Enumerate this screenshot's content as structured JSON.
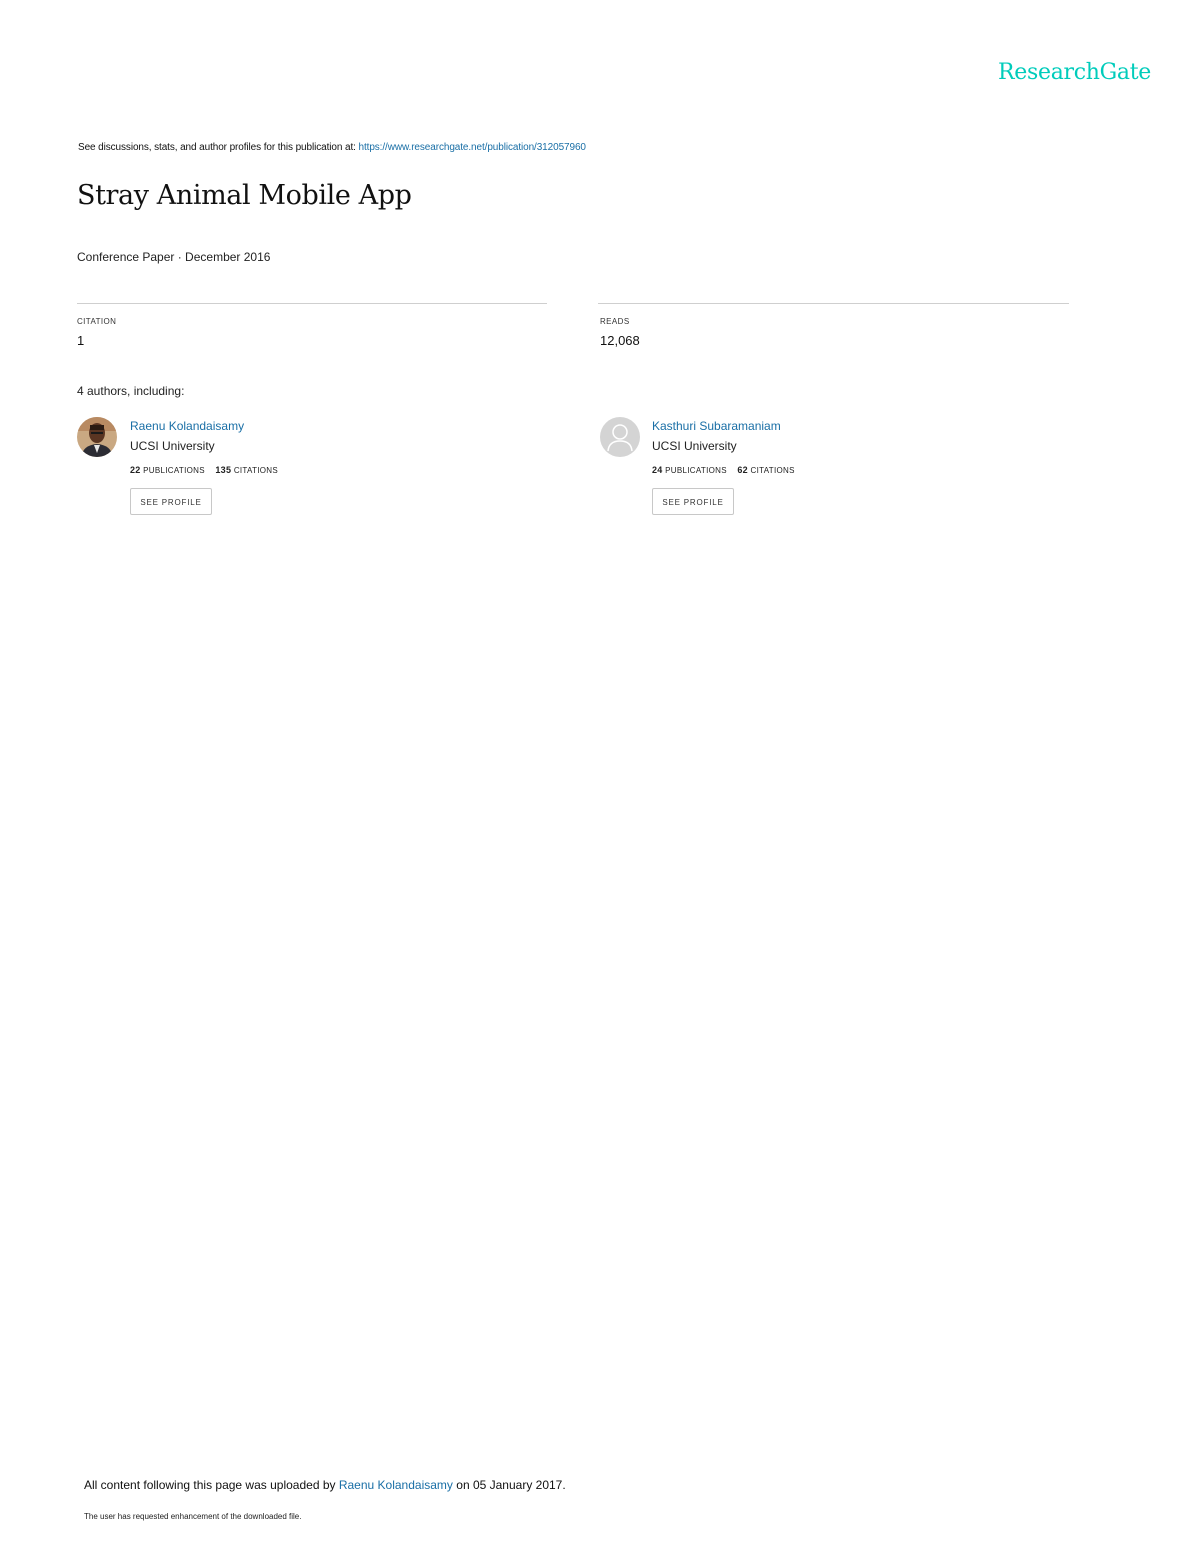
{
  "header": {
    "logo_text": "ResearchGate",
    "brand_color": "#00ccbb"
  },
  "see_line": {
    "label": "See discussions, stats, and author profiles for this publication at:",
    "url": "https://www.researchgate.net/publication/312057960"
  },
  "publication": {
    "title": "Stray Animal Mobile App",
    "type_line": "Conference Paper · December 2016"
  },
  "stats": {
    "citation_label": "CITATION",
    "citation_value": "1",
    "reads_label": "READS",
    "reads_value": "12,068"
  },
  "authors_heading": "4 authors, including:",
  "authors": [
    {
      "name": "Raenu Kolandaisamy",
      "institution": "UCSI University",
      "publications_count": "22",
      "publications_label": "PUBLICATIONS",
      "citations_count": "135",
      "citations_label": "CITATIONS",
      "button_label": "SEE PROFILE",
      "avatar": "author-photo"
    },
    {
      "name": "Kasthuri Subaramaniam",
      "institution": "UCSI University",
      "publications_count": "24",
      "publications_label": "PUBLICATIONS",
      "citations_count": "62",
      "citations_label": "CITATIONS",
      "button_label": "SEE PROFILE",
      "avatar": "default-user-icon"
    }
  ],
  "footer": {
    "upload_prefix": "All content following this page was uploaded by",
    "upload_author": "Raenu Kolandaisamy",
    "upload_suffix": "on 05 January 2017.",
    "note": "The user has requested enhancement of the downloaded file."
  },
  "colors": {
    "link": "#1a6fa6",
    "divider": "#cfcfcf"
  }
}
